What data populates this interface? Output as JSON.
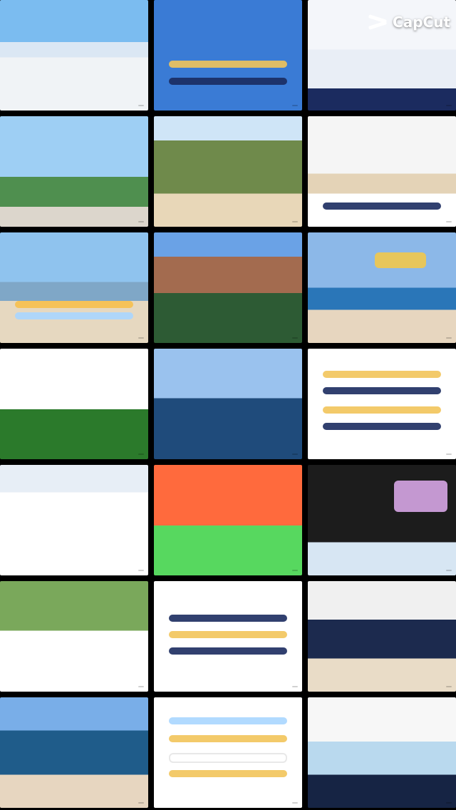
{
  "app": {
    "watermark": {
      "name": "CapCut",
      "icon": "capcut-logo-icon"
    }
  },
  "grid": {
    "tiles": [
      {
        "label": ""
      },
      {
        "label": ""
      },
      {
        "label": ""
      },
      {
        "label": ""
      },
      {
        "label": ""
      },
      {
        "label": ""
      },
      {
        "label": ""
      },
      {
        "label": ""
      },
      {
        "label": ""
      },
      {
        "label": ""
      },
      {
        "label": ""
      },
      {
        "label": ""
      },
      {
        "label": ""
      },
      {
        "label": ""
      },
      {
        "label": ""
      },
      {
        "label": ""
      },
      {
        "label": ""
      },
      {
        "label": ""
      },
      {
        "label": ""
      },
      {
        "label": ""
      },
      {
        "label": ""
      }
    ]
  }
}
